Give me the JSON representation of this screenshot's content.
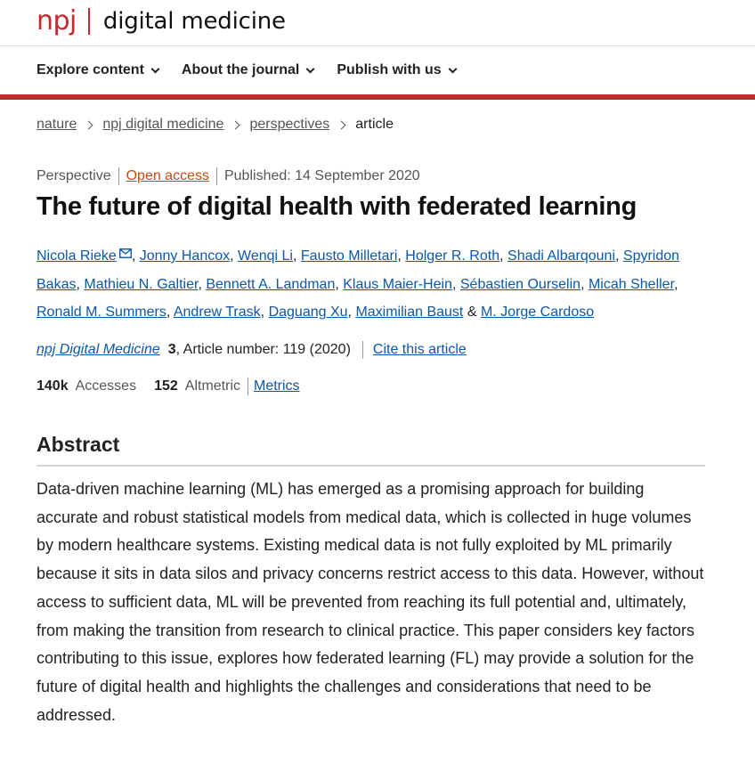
{
  "header": {
    "brand_short": "npj",
    "brand_title": "digital medicine"
  },
  "nav": {
    "items": [
      {
        "label": "Explore content"
      },
      {
        "label": "About the journal"
      },
      {
        "label": "Publish with us"
      }
    ]
  },
  "breadcrumb": {
    "items": [
      "nature",
      "npj digital medicine",
      "perspectives"
    ],
    "current": "article"
  },
  "meta": {
    "type": "Perspective",
    "access": "Open access",
    "published": "Published: 14 September 2020"
  },
  "article": {
    "title": "The future of digital health with federated learning"
  },
  "authors": {
    "list": [
      "Nicola Rieke",
      "Jonny Hancox",
      "Wenqi Li",
      "Fausto Milletari",
      "Holger R. Roth",
      "Shadi Albarqouni",
      "Spyridon Bakas",
      "Mathieu N. Galtier",
      "Bennett A. Landman",
      "Klaus Maier-Hein",
      "Sébastien Ourselin",
      "Micah Sheller",
      "Ronald M. Summers",
      "Andrew Trask",
      "Daguang Xu",
      "Maximilian Baust",
      "M. Jorge Cardoso"
    ],
    "conjunction": "&",
    "separator": ","
  },
  "citation": {
    "journal": "npj Digital Medicine",
    "volume": "3",
    "details": ", Article number: 119 (2020)",
    "cite_label": "Cite this article"
  },
  "metrics": {
    "accesses_count": "140k",
    "accesses_label": "Accesses",
    "altmetric_count": "152",
    "altmetric_label": "Altmetric",
    "metrics_link": "Metrics"
  },
  "abstract": {
    "heading": "Abstract",
    "text": "Data-driven machine learning (ML) has emerged as a promising approach for building accurate and robust statistical models from medical data, which is collected in huge volumes by modern healthcare systems. Existing medical data is not fully exploited by ML primarily because it sits in data silos and privacy concerns restrict access to this data. However, without access to sufficient data, ML will be prevented from reaching its full potential and, ultimately, from making the transition from research to clinical practice. This paper considers key factors contributing to this issue, explores how federated learning (FL) may provide a solution for the future of digital health and highlights the challenges and considerations that need to be addressed."
  },
  "colors": {
    "brand_red": "#c6282d",
    "link_blue": "#0c57a8",
    "open_access_orange": "#c84b0e"
  },
  "icons": {
    "mail": "envelope-icon"
  }
}
